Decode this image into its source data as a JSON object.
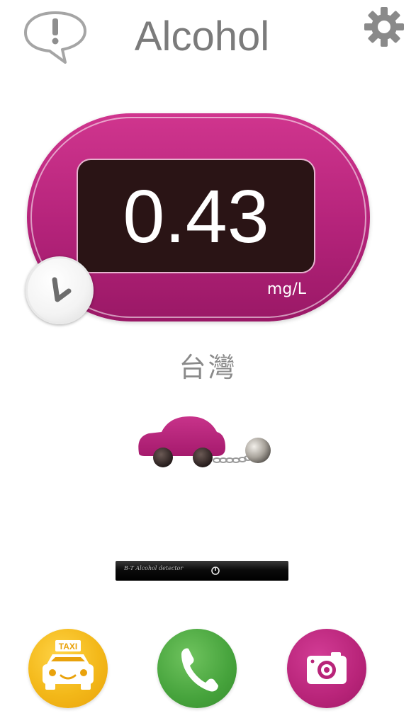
{
  "header": {
    "title": "Alcohol",
    "info_icon": "speech-bubble-exclamation-icon",
    "settings_icon": "gear-icon"
  },
  "meter": {
    "reading": "0.43",
    "unit": "mg/L",
    "timer_icon": "clock-icon",
    "accent_color": "#b4237a",
    "display_color": "#2a1415"
  },
  "region": {
    "label": "台灣"
  },
  "indicator": {
    "icon": "car-with-ball-and-chain-icon"
  },
  "device": {
    "label": "B-T Alcohol detector",
    "power_icon": "power-icon"
  },
  "actions": {
    "taxi": {
      "icon": "taxi-icon",
      "text": "TAXI",
      "color": "#f3b819"
    },
    "call": {
      "icon": "phone-icon",
      "color": "#46a33c"
    },
    "camera": {
      "icon": "camera-icon",
      "color": "#b82479"
    }
  }
}
